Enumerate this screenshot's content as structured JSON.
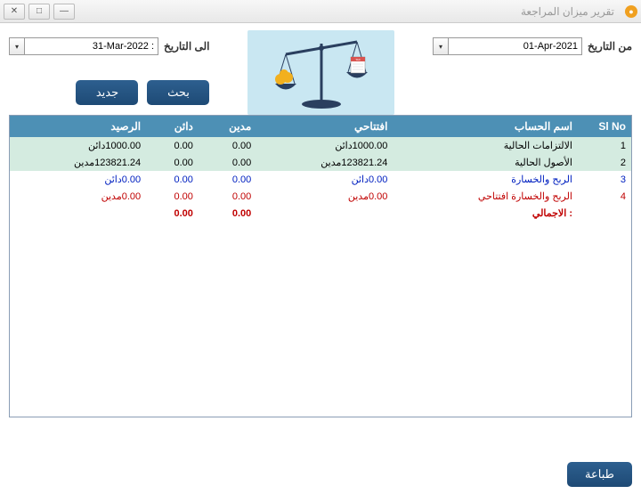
{
  "window": {
    "title": "تقرير ميزان المراجعة"
  },
  "filters": {
    "from_label": "من التاريخ",
    "to_label": "الى التاريخ",
    "from_value": "01-Apr-2021",
    "to_value": "31-Mar-2022 :"
  },
  "buttons": {
    "search": "بحث",
    "new": "جديد",
    "print": "طباعة"
  },
  "table": {
    "headers": {
      "sl": "Sl No",
      "account": "اسم الحساب",
      "opening": "افتتاحي",
      "debit": "مدين",
      "credit": "دائن",
      "balance": "الرصيد"
    },
    "rows": [
      {
        "sl": "1",
        "account": "الالتزامات الحالية",
        "opening": "1000.00دائن",
        "debit": "0.00",
        "credit": "0.00",
        "balance": "1000.00دائن",
        "cls": "r-even"
      },
      {
        "sl": "2",
        "account": "الأصول الحالية",
        "opening": "123821.24مدين",
        "debit": "0.00",
        "credit": "0.00",
        "balance": "123821.24مدين",
        "cls": "r-even"
      },
      {
        "sl": "3",
        "account": "الربح والخسارة",
        "opening": "0.00دائن",
        "debit": "0.00",
        "credit": "0.00",
        "balance": "0.00دائن",
        "cls": "r-odd"
      },
      {
        "sl": "4",
        "account": "الربح والخسارة افتتاحي",
        "opening": "0.00مدين",
        "debit": "0.00",
        "credit": "0.00",
        "balance": "0.00مدين",
        "cls": "r-red"
      }
    ],
    "total": {
      "label": ": الاجمالي",
      "opening": "",
      "debit": "0.00",
      "credit": "0.00",
      "balance": ""
    }
  }
}
